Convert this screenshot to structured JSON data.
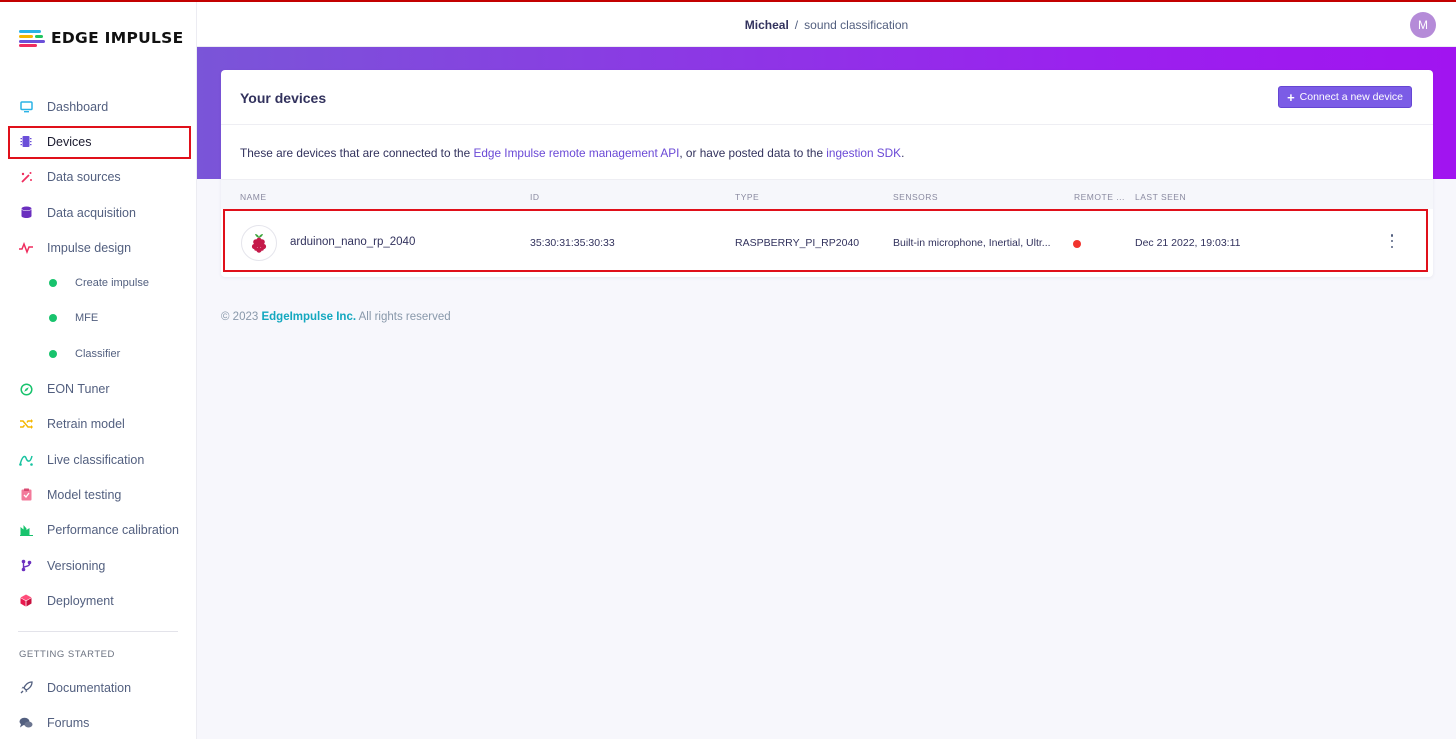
{
  "brand": {
    "name": "EDGE IMPULSE",
    "accent": "#7b5ce6"
  },
  "header": {
    "user": "Micheal",
    "separator": "/",
    "project": "sound classification",
    "avatar_initial": "M"
  },
  "sidebar": {
    "items": [
      {
        "label": "Dashboard",
        "icon": "monitor-icon"
      },
      {
        "label": "Devices",
        "icon": "chip-icon"
      },
      {
        "label": "Data sources",
        "icon": "wand-icon"
      },
      {
        "label": "Data acquisition",
        "icon": "database-icon"
      },
      {
        "label": "Impulse design",
        "icon": "pulse-icon"
      },
      {
        "label": "Create impulse",
        "icon": "status-dot-icon"
      },
      {
        "label": "MFE",
        "icon": "status-dot-icon"
      },
      {
        "label": "Classifier",
        "icon": "status-dot-icon"
      },
      {
        "label": "EON Tuner",
        "icon": "compass-icon"
      },
      {
        "label": "Retrain model",
        "icon": "shuffle-icon"
      },
      {
        "label": "Live classification",
        "icon": "graph-icon"
      },
      {
        "label": "Model testing",
        "icon": "clipboard-icon"
      },
      {
        "label": "Performance calibration",
        "icon": "bar-chart-icon"
      },
      {
        "label": "Versioning",
        "icon": "branch-icon"
      },
      {
        "label": "Deployment",
        "icon": "cube-icon"
      }
    ],
    "getting_started_title": "GETTING STARTED",
    "getting_started": [
      {
        "label": "Documentation",
        "icon": "rocket-icon"
      },
      {
        "label": "Forums",
        "icon": "chat-icon"
      }
    ]
  },
  "card": {
    "title": "Your devices",
    "connect_label": "Connect a new device",
    "description_prefix": "These are devices that are connected to the ",
    "description_link1": "Edge Impulse remote management API",
    "description_middle": ", or have posted data to the ",
    "description_link2": "ingestion SDK",
    "description_suffix": "."
  },
  "table": {
    "columns": [
      "NAME",
      "ID",
      "TYPE",
      "SENSORS",
      "REMOTE ...",
      "LAST SEEN"
    ],
    "rows": [
      {
        "name": "arduinon_nano_rp_2040",
        "id": "35:30:31:35:30:33",
        "type": "RASPBERRY_PI_RP2040",
        "sensors": "Built-in microphone, Inertial, Ultr...",
        "remote_status_color": "#f1342e",
        "last_seen": "Dec 21 2022, 19:03:11",
        "icon": "raspberry-pi-icon"
      }
    ]
  },
  "footer": {
    "copyright": "© 2023",
    "company": "EdgeImpulse Inc.",
    "rights": "All rights reserved"
  }
}
